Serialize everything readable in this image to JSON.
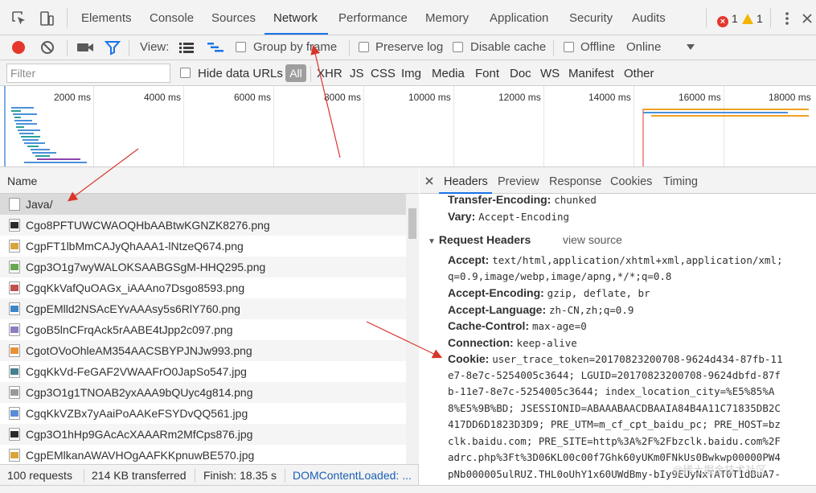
{
  "tabs": [
    "Elements",
    "Console",
    "Sources",
    "Network",
    "Performance",
    "Memory",
    "Application",
    "Security",
    "Audits"
  ],
  "active_tab": "Network",
  "badges": {
    "errors": "1",
    "warnings": "1"
  },
  "toolbar": {
    "view_label": "View:",
    "group_by_frame": "Group by frame",
    "preserve_log": "Preserve log",
    "disable_cache": "Disable cache",
    "offline": "Offline",
    "throttling": "Online"
  },
  "filter": {
    "placeholder": "Filter",
    "hide_data_urls": "Hide data URLs",
    "all": "All",
    "types": [
      "XHR",
      "JS",
      "CSS",
      "Img",
      "Media",
      "Font",
      "Doc",
      "WS",
      "Manifest",
      "Other"
    ]
  },
  "overview": {
    "ticks": [
      "2000 ms",
      "4000 ms",
      "6000 ms",
      "8000 ms",
      "10000 ms",
      "12000 ms",
      "14000 ms",
      "16000 ms",
      "18000 ms"
    ]
  },
  "list": {
    "header": "Name",
    "rows": [
      "Java/",
      "Cgo8PFTUWCWAOQHbAABtwKGNZK8276.png",
      "CgpFT1lbMmCAJyQhAAA1-lNtzeQ674.png",
      "Cgp3O1g7wyWALOKSAABGSgM-HHQ295.png",
      "CgqKkVafQuOAGx_iAAAno7Dsgo8593.png",
      "CgpEMlld2NSAcEYvAAAsy5s6RlY760.png",
      "CgoB5lnCFrqAck5rAABE4tJpp2c097.png",
      "CgotOVoOhleAM354AACSBYPJNJw993.png",
      "CgqKkVd-FeGAF2VWAAFrO0JapSo547.jpg",
      "Cgp3O1g1TNOAB2yxAAA9bQUyc4g814.png",
      "CgqKkVZBx7yAaiPoAAKeFSYDvQQ561.jpg",
      "Cgp3O1hHp9GAcAcXAAARm2MfCps876.jpg",
      "CgpEMlkanAWAVHOgAAFKKpnuwBE570.jpg"
    ],
    "selected_index": 0
  },
  "status": {
    "requests": "100 requests",
    "transferred": "214 KB transferred",
    "finish": "Finish: 18.35 s",
    "domcontentloaded": "DOMContentLoaded: ..."
  },
  "details": {
    "tabs": [
      "Headers",
      "Preview",
      "Response",
      "Cookies",
      "Timing"
    ],
    "active_tab": "Headers",
    "response_headers_tail": [
      {
        "key": "Transfer-Encoding:",
        "value": "chunked"
      },
      {
        "key": "Vary:",
        "value": "Accept-Encoding"
      }
    ],
    "request_headers_title": "Request Headers",
    "view_source": "view source",
    "request_headers": [
      {
        "key": "Accept:",
        "value": "text/html,application/xhtml+xml,application/xml;",
        "cont": [
          "q=0.9,image/webp,image/apng,*/*;q=0.8"
        ]
      },
      {
        "key": "Accept-Encoding:",
        "value": "gzip, deflate, br",
        "cont": []
      },
      {
        "key": "Accept-Language:",
        "value": "zh-CN,zh;q=0.9",
        "cont": []
      },
      {
        "key": "Cache-Control:",
        "value": "max-age=0",
        "cont": []
      },
      {
        "key": "Connection:",
        "value": "keep-alive",
        "cont": []
      },
      {
        "key": "Cookie:",
        "value": "user_trace_token=20170823200708-9624d434-87fb-11",
        "cont": [
          "e7-8e7c-5254005c3644; LGUID=20170823200708-9624dbfd-87f",
          "b-11e7-8e7c-5254005c3644; index_location_city=%E5%85%A",
          "8%E5%9B%BD; JSESSIONID=ABAAABAACDBAAIA84B4A11C71835DB2C",
          "417DD6D1823D3D9; PRE_UTM=m_cf_cpt_baidu_pc; PRE_HOST=bz",
          "clk.baidu.com; PRE_SITE=http%3A%2F%2Fbzclk.baidu.com%2F",
          "adrc.php%3Ft%3D06KL00c00f7Ghk60yUKm0FNkUs0Bwkwp00000PW4",
          "pNb000005ulRUZ.THL0oUhY1x60UWdBmy-bIy9EUyNxTAT0T1dBuA7-"
        ]
      }
    ]
  },
  "watermark": "@稀土掘金技术社区",
  "colors": {
    "accent": "#1a73e8",
    "record": "#e6372d",
    "selected_row": "#dadada",
    "overview_blue": "#4a90d9",
    "overview_green": "#2aa198",
    "overview_orange": "#f0a020"
  }
}
